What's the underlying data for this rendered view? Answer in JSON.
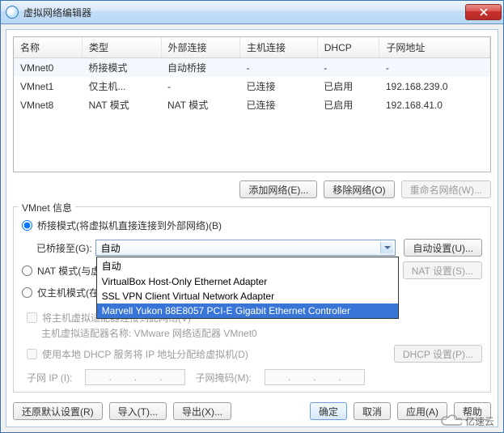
{
  "title": "虚拟网络编辑器",
  "table": {
    "headers": [
      "名称",
      "类型",
      "外部连接",
      "主机连接",
      "DHCP",
      "子网地址"
    ],
    "rows": [
      {
        "name": "VMnet0",
        "type": "桥接模式",
        "ext": "自动桥接",
        "host": "-",
        "dhcp": "-",
        "subnet": "-"
      },
      {
        "name": "VMnet1",
        "type": "仅主机...",
        "ext": "-",
        "host": "已连接",
        "dhcp": "已启用",
        "subnet": "192.168.239.0"
      },
      {
        "name": "VMnet8",
        "type": "NAT 模式",
        "ext": "NAT 模式",
        "host": "已连接",
        "dhcp": "已启用",
        "subnet": "192.168.41.0"
      }
    ]
  },
  "buttons": {
    "add_net": "添加网络(E)...",
    "remove_net": "移除网络(O)",
    "rename_net": "重命名网络(W)...",
    "auto_set": "自动设置(U)...",
    "nat_set": "NAT 设置(S)...",
    "dhcp_set": "DHCP 设置(P)...",
    "restore": "还原默认设置(R)",
    "import": "导入(T)...",
    "export": "导出(X)...",
    "ok": "确定",
    "cancel": "取消",
    "apply": "应用(A)",
    "help": "帮助"
  },
  "group": {
    "legend": "VMnet 信息",
    "radio_bridge": "桥接模式(将虚拟机直接连接到外部网络)(B)",
    "bridge_to_label": "已桥接至(G):",
    "bridge_to_value": "自动",
    "radio_nat": "NAT 模式(与虚",
    "radio_host": "仅主机模式(在",
    "chk_host_connect": "将主机虚拟适配器连接到此网络(V)",
    "host_adapter_sub": "主机虚拟适配器名称: VMware 网络适配器 VMnet0",
    "chk_dhcp": "使用本地 DHCP 服务将 IP 地址分配给虚拟机(D)",
    "subnet_ip_label": "子网 IP (I):",
    "subnet_mask_label": "子网掩码(M):"
  },
  "dropdown": {
    "items": [
      "自动",
      "VirtualBox Host-Only Ethernet Adapter",
      "SSL VPN Client Virtual Network Adapter",
      "Marvell Yukon 88E8057 PCI-E Gigabit Ethernet Controller"
    ]
  },
  "logo_text": "亿速云"
}
